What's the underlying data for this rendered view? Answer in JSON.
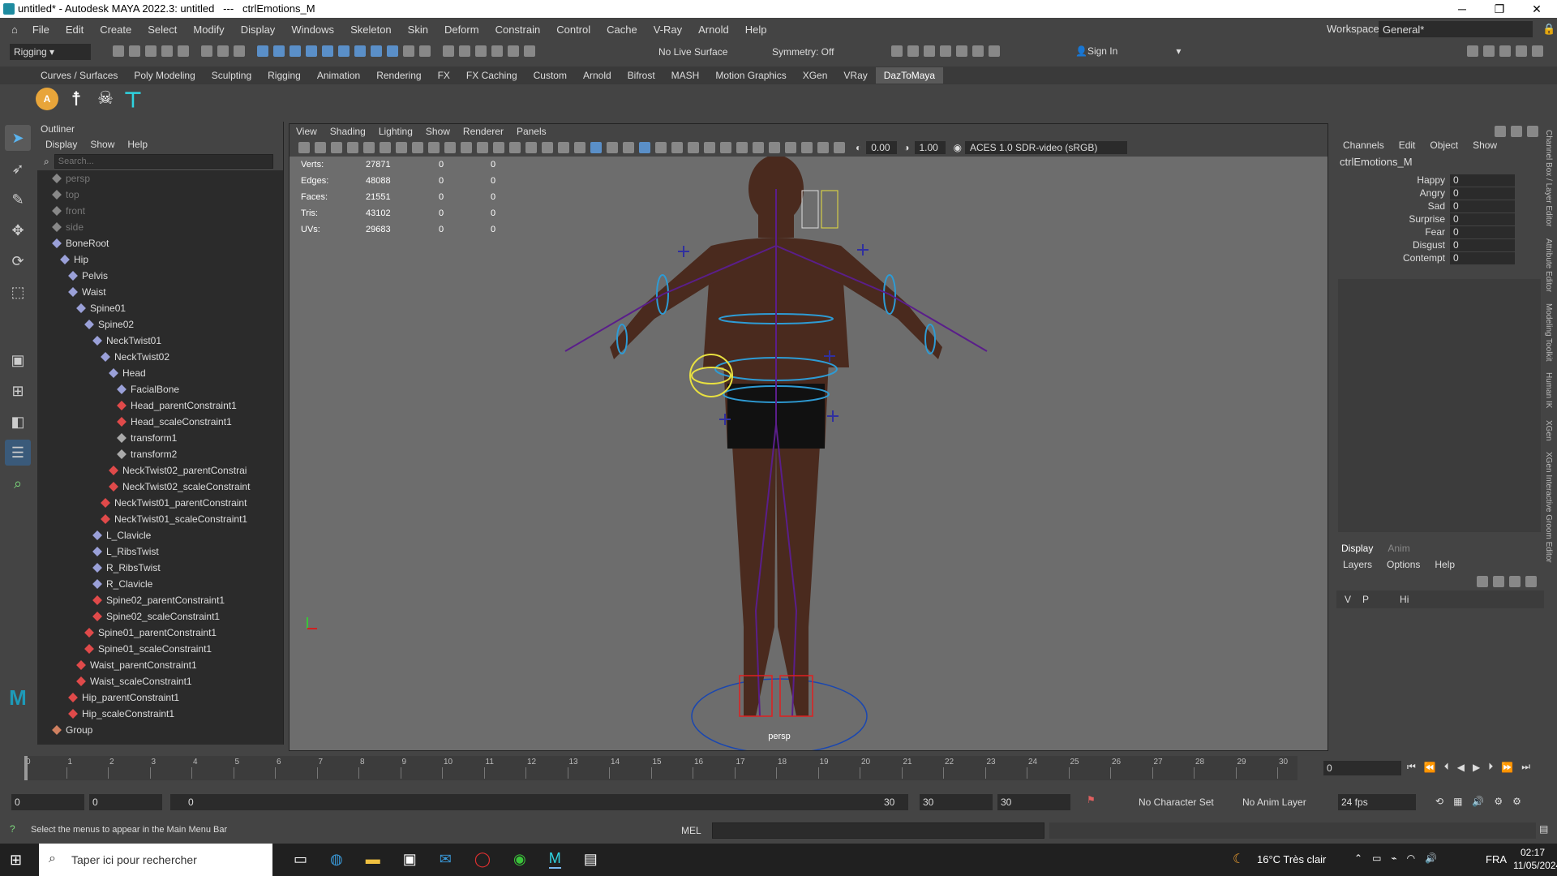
{
  "window": {
    "title": "untitled* - Autodesk MAYA 2022.3: untitled   ---   ctrlEmotions_M",
    "minimize": "─",
    "maximize": "❐",
    "close": "✕"
  },
  "menubar": {
    "items": [
      "File",
      "Edit",
      "Create",
      "Select",
      "Modify",
      "Display",
      "Windows",
      "Skeleton",
      "Skin",
      "Deform",
      "Constrain",
      "Control",
      "Cache",
      "V-Ray",
      "Arnold",
      "Help"
    ],
    "workspace_label": "Workspace:",
    "workspace_value": "General*"
  },
  "statusline": {
    "mode": "Rigging",
    "live_surface": "No Live Surface",
    "symmetry": "Symmetry: Off",
    "sign_in": "Sign In"
  },
  "shelf": {
    "tabs": [
      "Curves / Surfaces",
      "Poly Modeling",
      "Sculpting",
      "Rigging",
      "Animation",
      "Rendering",
      "FX",
      "FX Caching",
      "Custom",
      "Arnold",
      "Bifrost",
      "MASH",
      "Motion Graphics",
      "XGen",
      "VRay",
      "DazToMaya"
    ],
    "active_tab": "DazToMaya"
  },
  "outliner": {
    "title": "Outliner",
    "menu": [
      "Display",
      "Show",
      "Help"
    ],
    "search_placeholder": "Search...",
    "items": [
      {
        "label": "persp",
        "indent": 1,
        "type": "cam"
      },
      {
        "label": "top",
        "indent": 1,
        "type": "cam"
      },
      {
        "label": "front",
        "indent": 1,
        "type": "cam"
      },
      {
        "label": "side",
        "indent": 1,
        "type": "cam"
      },
      {
        "label": "BoneRoot",
        "indent": 1,
        "type": "joint"
      },
      {
        "label": "Hip",
        "indent": 2,
        "type": "joint"
      },
      {
        "label": "Pelvis",
        "indent": 3,
        "type": "joint"
      },
      {
        "label": "Waist",
        "indent": 3,
        "type": "joint"
      },
      {
        "label": "Spine01",
        "indent": 4,
        "type": "joint"
      },
      {
        "label": "Spine02",
        "indent": 5,
        "type": "joint"
      },
      {
        "label": "NeckTwist01",
        "indent": 6,
        "type": "joint"
      },
      {
        "label": "NeckTwist02",
        "indent": 7,
        "type": "joint"
      },
      {
        "label": "Head",
        "indent": 8,
        "type": "joint"
      },
      {
        "label": "FacialBone",
        "indent": 9,
        "type": "joint"
      },
      {
        "label": "Head_parentConstraint1",
        "indent": 9,
        "type": "constraint"
      },
      {
        "label": "Head_scaleConstraint1",
        "indent": 9,
        "type": "constraint"
      },
      {
        "label": "transform1",
        "indent": 9,
        "type": "transform"
      },
      {
        "label": "transform2",
        "indent": 9,
        "type": "transform"
      },
      {
        "label": "NeckTwist02_parentConstrai",
        "indent": 8,
        "type": "constraint"
      },
      {
        "label": "NeckTwist02_scaleConstraint",
        "indent": 8,
        "type": "constraint"
      },
      {
        "label": "NeckTwist01_parentConstraint",
        "indent": 7,
        "type": "constraint"
      },
      {
        "label": "NeckTwist01_scaleConstraint1",
        "indent": 7,
        "type": "constraint"
      },
      {
        "label": "L_Clavicle",
        "indent": 6,
        "type": "joint"
      },
      {
        "label": "L_RibsTwist",
        "indent": 6,
        "type": "joint"
      },
      {
        "label": "R_RibsTwist",
        "indent": 6,
        "type": "joint"
      },
      {
        "label": "R_Clavicle",
        "indent": 6,
        "type": "joint"
      },
      {
        "label": "Spine02_parentConstraint1",
        "indent": 6,
        "type": "constraint"
      },
      {
        "label": "Spine02_scaleConstraint1",
        "indent": 6,
        "type": "constraint"
      },
      {
        "label": "Spine01_parentConstraint1",
        "indent": 5,
        "type": "constraint"
      },
      {
        "label": "Spine01_scaleConstraint1",
        "indent": 5,
        "type": "constraint"
      },
      {
        "label": "Waist_parentConstraint1",
        "indent": 4,
        "type": "constraint"
      },
      {
        "label": "Waist_scaleConstraint1",
        "indent": 4,
        "type": "constraint"
      },
      {
        "label": "Hip_parentConstraint1",
        "indent": 3,
        "type": "constraint"
      },
      {
        "label": "Hip_scaleConstraint1",
        "indent": 3,
        "type": "constraint"
      },
      {
        "label": "Group",
        "indent": 1,
        "type": "group"
      }
    ]
  },
  "viewport": {
    "menu": [
      "View",
      "Shading",
      "Lighting",
      "Show",
      "Renderer",
      "Panels"
    ],
    "exposure": "0.00",
    "gamma": "1.00",
    "color_space": "ACES 1.0 SDR-video (sRGB)",
    "camera": "persp",
    "hud": [
      {
        "label": "Verts:",
        "v": "27871",
        "a": "0",
        "b": "0"
      },
      {
        "label": "Edges:",
        "v": "48088",
        "a": "0",
        "b": "0"
      },
      {
        "label": "Faces:",
        "v": "21551",
        "a": "0",
        "b": "0"
      },
      {
        "label": "Tris:",
        "v": "43102",
        "a": "0",
        "b": "0"
      },
      {
        "label": "UVs:",
        "v": "29683",
        "a": "0",
        "b": "0"
      }
    ]
  },
  "channelbox": {
    "menu": [
      "Channels",
      "Edit",
      "Object",
      "Show"
    ],
    "object": "ctrlEmotions_M",
    "channels": [
      {
        "name": "Happy",
        "value": "0"
      },
      {
        "name": "Angry",
        "value": "0"
      },
      {
        "name": "Sad",
        "value": "0"
      },
      {
        "name": "Surprise",
        "value": "0"
      },
      {
        "name": "Fear",
        "value": "0"
      },
      {
        "name": "Disgust",
        "value": "0"
      },
      {
        "name": "Contempt",
        "value": "0"
      }
    ]
  },
  "layereditor": {
    "tabs": [
      "Display",
      "Anim"
    ],
    "menu": [
      "Layers",
      "Options",
      "Help"
    ],
    "v": "V",
    "p": "P",
    "hi": "Hi"
  },
  "sidetabs": [
    "Channel Box / Layer Editor",
    "Attribute Editor",
    "Modeling Toolkit",
    "Human IK",
    "XGen",
    "XGen Interactive Groom Editor"
  ],
  "timeline": {
    "ticks": [
      "0",
      "1",
      "2",
      "3",
      "4",
      "5",
      "6",
      "7",
      "8",
      "9",
      "10",
      "11",
      "12",
      "13",
      "14",
      "15",
      "16",
      "17",
      "18",
      "19",
      "20",
      "21",
      "22",
      "23",
      "24",
      "25",
      "26",
      "27",
      "28",
      "29",
      "30"
    ],
    "current": "0",
    "current_frame_field": "0"
  },
  "range": {
    "start": "0",
    "anim_start": "0",
    "slider_start": "0",
    "slider_end": "30",
    "end": "30",
    "anim_end": "30",
    "character_set": "No Character Set",
    "anim_layer": "No Anim Layer",
    "fps": "24 fps"
  },
  "cmd": {
    "help": "Select the menus to appear in the Main Menu Bar",
    "lang": "MEL"
  },
  "taskbar": {
    "search": "Taper ici pour rechercher",
    "weather": "16°C  Très clair",
    "lang": "FRA",
    "time": "02:17",
    "date": "11/05/2024"
  }
}
